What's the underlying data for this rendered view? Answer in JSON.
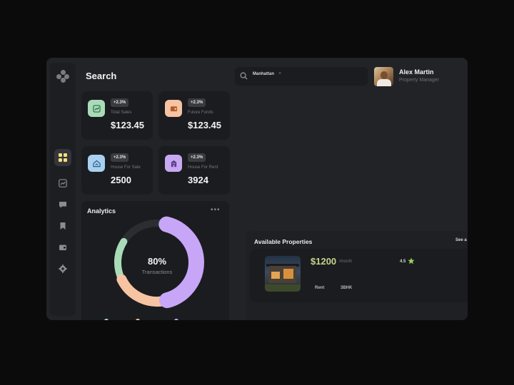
{
  "header": {
    "title": "Search"
  },
  "search": {
    "tag": "Manhattan",
    "tag_close": "×"
  },
  "profile": {
    "name": "Alex Martin",
    "role": "Property Manager"
  },
  "sidebar": {
    "icons": [
      "logo-icon",
      "dashboard-icon",
      "chart-icon",
      "message-icon",
      "bookmark-icon",
      "wallet-icon",
      "settings-icon"
    ]
  },
  "stats": [
    {
      "badge": "+2.3%",
      "label": "Total Sales",
      "value": "$123.45",
      "color": "#a9dbb9",
      "icon": "chart-up-icon"
    },
    {
      "badge": "+2.3%",
      "label": "Future Funds",
      "value": "$123.45",
      "color": "#f6c3a3",
      "icon": "wallet-icon"
    },
    {
      "badge": "+2.3%",
      "label": "House For Sale",
      "value": "2500",
      "color": "#a8d0f0",
      "icon": "home-icon"
    },
    {
      "badge": "+2.3%",
      "label": "House For Rent",
      "value": "3924",
      "color": "#c9a8f2",
      "icon": "building-icon"
    }
  ],
  "analytics": {
    "title": "Analytics",
    "more": "•••",
    "percent": "80%",
    "percent_label": "Transactions",
    "segments": [
      {
        "name": "purple",
        "fraction": 0.42,
        "color": "#c7a6f7"
      },
      {
        "name": "peach",
        "fraction": 0.22,
        "color": "#f6c3a3"
      },
      {
        "name": "green",
        "fraction": 0.16,
        "color": "#a9dbb9"
      },
      {
        "name": "track",
        "fraction": 0.2,
        "color": "#2c2d31"
      }
    ]
  },
  "properties": {
    "title": "Available Properties",
    "see_all": "See a",
    "item": {
      "price": "$1200",
      "per": "/month",
      "rating": "4.5",
      "type_value": "Rent",
      "size_value": "3BHK"
    }
  }
}
